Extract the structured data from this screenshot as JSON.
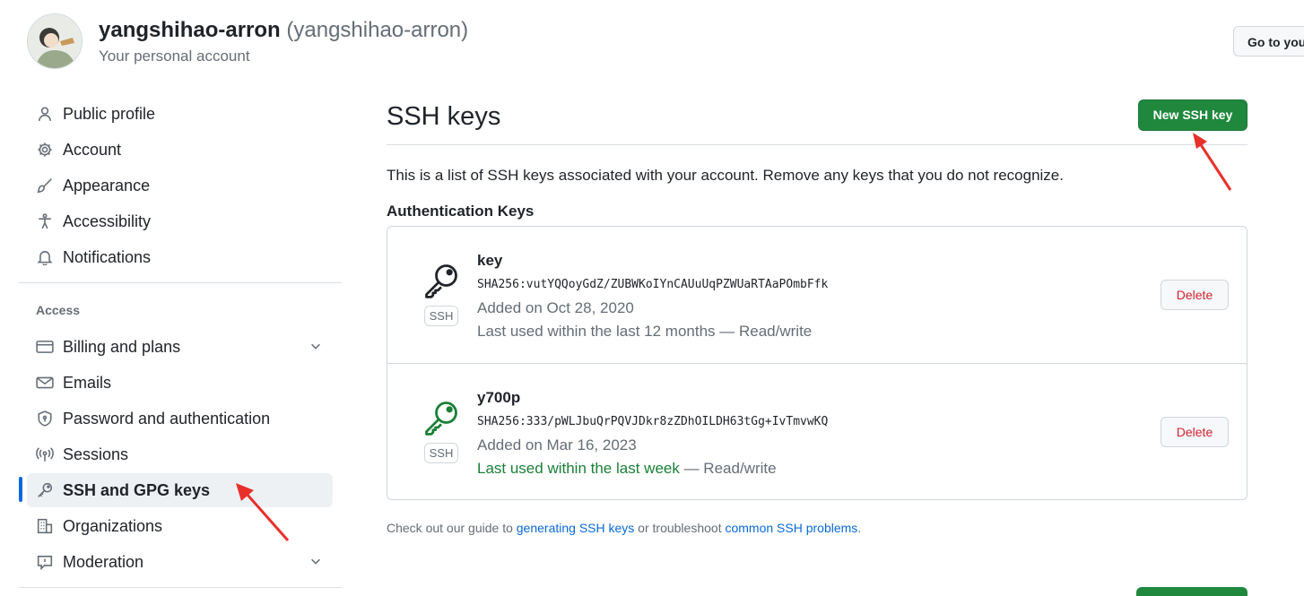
{
  "header": {
    "display_name": "yangshihao-arron",
    "login": "(yangshihao-arron)",
    "subtitle": "Your personal account",
    "goto_label": "Go to your"
  },
  "sidebar": {
    "items": [
      {
        "label": "Public profile",
        "icon": "person-icon"
      },
      {
        "label": "Account",
        "icon": "gear-icon"
      },
      {
        "label": "Appearance",
        "icon": "paintbrush-icon"
      },
      {
        "label": "Accessibility",
        "icon": "accessibility-icon"
      },
      {
        "label": "Notifications",
        "icon": "bell-icon"
      }
    ],
    "section_title": "Access",
    "access_items": [
      {
        "label": "Billing and plans",
        "icon": "credit-card-icon",
        "expandable": true
      },
      {
        "label": "Emails",
        "icon": "mail-icon"
      },
      {
        "label": "Password and authentication",
        "icon": "shield-lock-icon"
      },
      {
        "label": "Sessions",
        "icon": "broadcast-icon"
      },
      {
        "label": "SSH and GPG keys",
        "icon": "key-icon",
        "active": true
      },
      {
        "label": "Organizations",
        "icon": "organization-icon"
      },
      {
        "label": "Moderation",
        "icon": "report-icon",
        "expandable": true
      }
    ]
  },
  "main": {
    "title": "SSH keys",
    "new_button": "New SSH key",
    "description": "This is a list of SSH keys associated with your account. Remove any keys that you do not recognize.",
    "auth_heading": "Authentication Keys",
    "keys": [
      {
        "title": "key",
        "fingerprint": "SHA256:vutYQQoyGdZ/ZUBWKoIYnCAUuUqPZWUaRTAaPOmbFfk",
        "added": "Added on Oct 28, 2020",
        "last_used": "Last used within the last 12 months",
        "access": " — Read/write",
        "badge": "SSH",
        "delete_label": "Delete",
        "recent": false
      },
      {
        "title": "y700p",
        "fingerprint": "SHA256:333/pWLJbuQrPQVJDkr8zZDhOILDH63tGg+IvTmvwKQ",
        "added": "Added on Mar 16, 2023",
        "last_used": "Last used within the last week",
        "access": " — Read/write",
        "badge": "SSH",
        "delete_label": "Delete",
        "recent": true
      }
    ],
    "footer": {
      "prefix": "Check out our guide to ",
      "link1": "generating SSH keys",
      "middle": " or troubleshoot ",
      "link2": "common SSH problems",
      "suffix": "."
    }
  },
  "colors": {
    "primary_green": "#1f883d",
    "accent_blue": "#0969da",
    "danger_red": "#cf222e",
    "annotation_red": "#e8302a"
  }
}
